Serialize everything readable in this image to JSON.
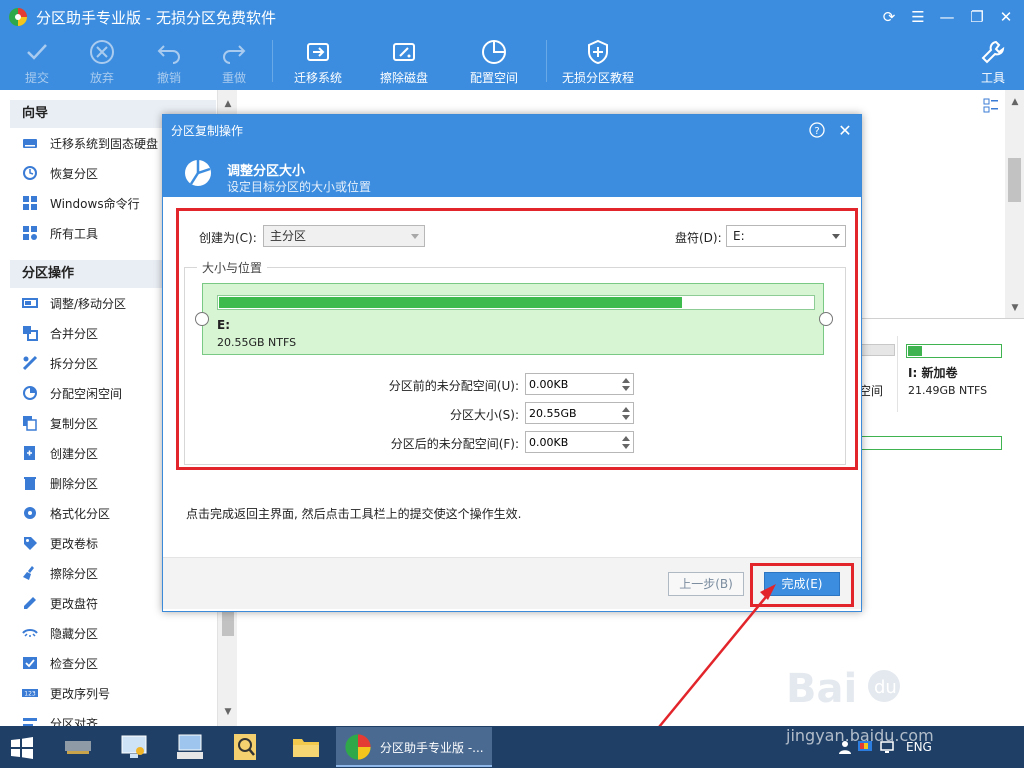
{
  "app": {
    "title": "分区助手专业版 - 无损分区免费软件"
  },
  "toolbar": {
    "submit": "提交",
    "discard": "放弃",
    "undo": "撤销",
    "redo": "重做",
    "migrate_os": "迁移系统",
    "wipe_disk": "擦除磁盘",
    "config_space": "配置空间",
    "tutorial": "无损分区教程",
    "tools": "工具"
  },
  "sidebar": {
    "wizard_title": "向导",
    "wizard_items": [
      "迁移系统到固态硬盘",
      "恢复分区",
      "Windows命令行",
      "所有工具"
    ],
    "ops_title": "分区操作",
    "ops_items": [
      "调整/移动分区",
      "合并分区",
      "拆分分区",
      "分配空闲空间",
      "复制分区",
      "创建分区",
      "删除分区",
      "格式化分区",
      "更改卷标",
      "擦除分区",
      "更改盘符",
      "隐藏分区",
      "检查分区",
      "更改序列号",
      "分区对齐"
    ]
  },
  "background": {
    "card_e_label": "空间",
    "card_i_name": "I: 新加卷",
    "card_i_size": "21.49GB NTFS",
    "card_i_fill": 0.15
  },
  "dialog": {
    "title": "分区复制操作",
    "header_title": "调整分区大小",
    "header_subtitle": "设定目标分区的大小或位置",
    "create_as_label": "创建为(C):",
    "create_as_value": "主分区",
    "drive_letter_label": "盘符(D):",
    "drive_letter_value": "E:",
    "group_title": "大小与位置",
    "partition": {
      "letter": "E:",
      "size": "20.55GB NTFS",
      "fill_fraction": 0.78
    },
    "unalloc_before_label": "分区前的未分配空间(U):",
    "unalloc_before_value": "0.00KB",
    "part_size_label": "分区大小(S):",
    "part_size_value": "20.55GB",
    "unalloc_after_label": "分区后的未分配空间(F):",
    "unalloc_after_value": "0.00KB",
    "hint": "点击完成返回主界面, 然后点击工具栏上的提交使这个操作生效.",
    "prev_button": "上一步(B)",
    "finish_button": "完成(E)"
  },
  "taskbar": {
    "active_app": "分区助手专业版 -...",
    "lang": "ENG"
  },
  "watermark": {
    "text": "jingyan.baidu.com"
  },
  "colors": {
    "accent": "#3c8ddf",
    "highlight_red": "#e2252b",
    "partition_green": "#3dbb4d",
    "taskbar": "#1f3f66"
  }
}
